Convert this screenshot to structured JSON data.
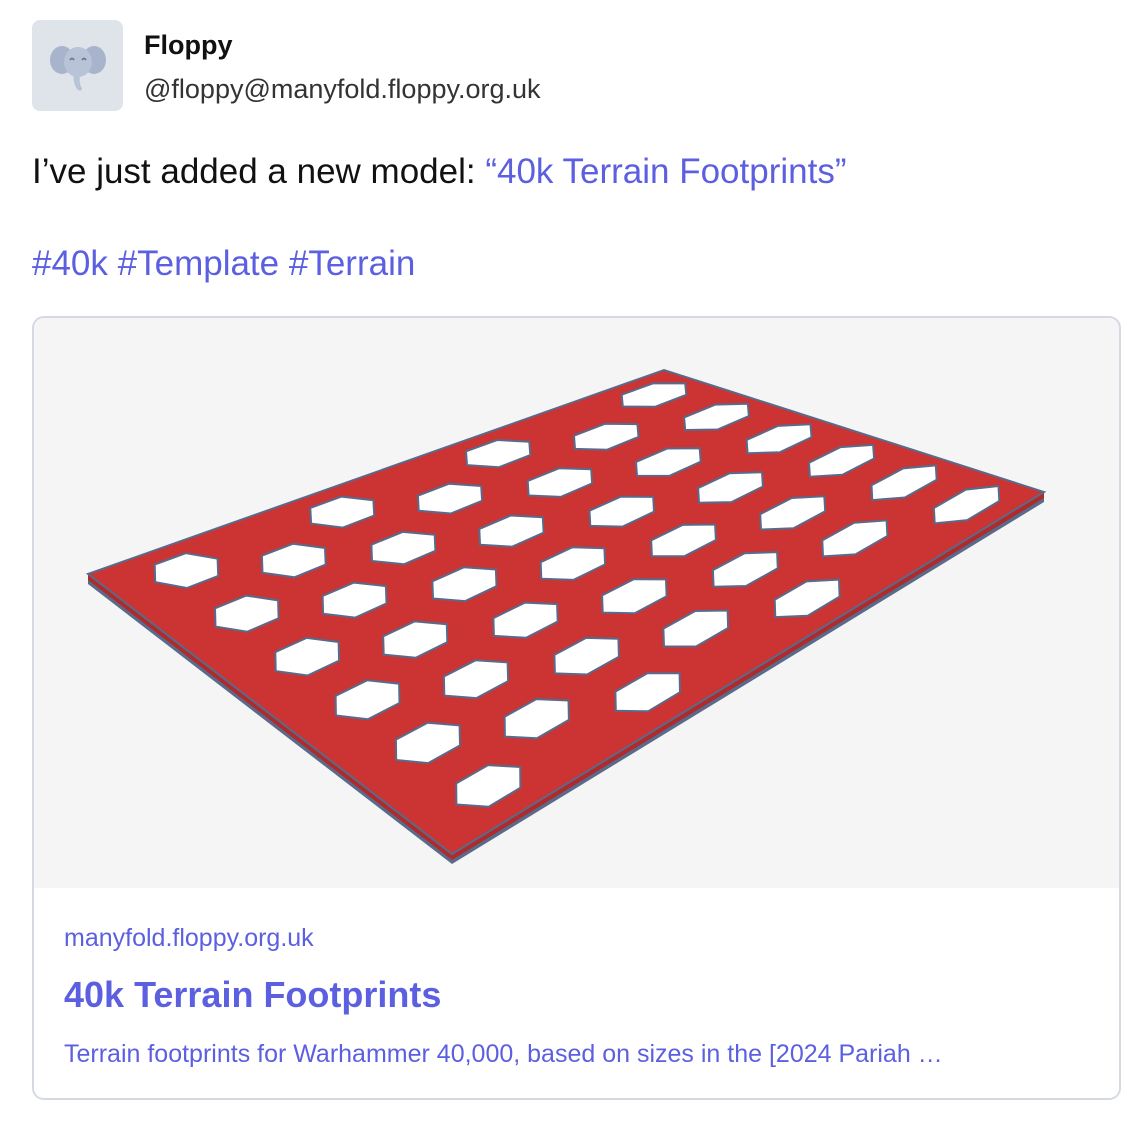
{
  "author": {
    "display_name": "Floppy",
    "handle": "@floppy@manyfold.floppy.org.uk",
    "avatar_icon": "elephant-icon"
  },
  "post": {
    "text_prefix": "I’ve just added a new model: ",
    "link_text": "“40k Terrain Footprints”",
    "hashtags": [
      "#40k",
      "#Template",
      "#Terrain"
    ]
  },
  "card": {
    "domain": "manyfold.floppy.org.uk",
    "title": "40k Terrain Footprints",
    "description": "Terrain footprints for Warhammer 40,000, based on sizes in the [2024 Pariah …"
  },
  "colors": {
    "link": "#5b5fe0",
    "plate": "#cc3333",
    "plate_edge": "#5a6a8a",
    "image_bg": "#f5f5f5"
  }
}
